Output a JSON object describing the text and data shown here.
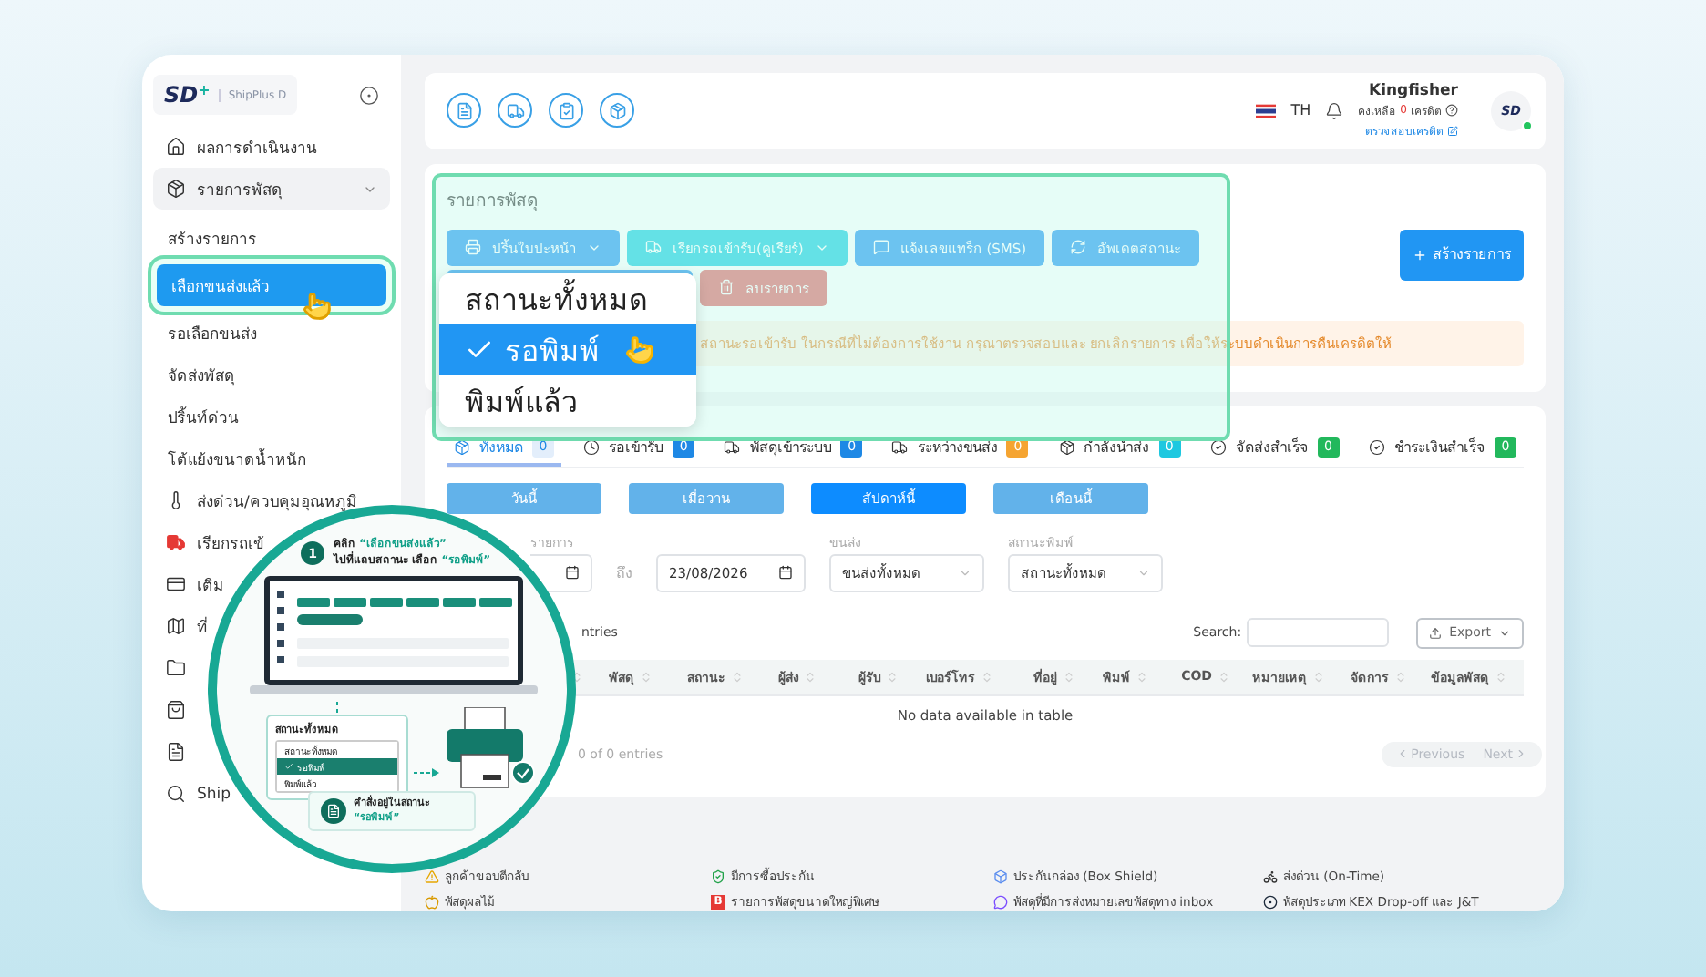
{
  "sidebar": {
    "logo": "SD",
    "logo_plus": "+",
    "brand": "ShipPlus D",
    "items": [
      {
        "label": "ผลการดำเนินงาน"
      },
      {
        "label": "รายการพัสดุ",
        "expanded": true,
        "children": [
          {
            "label": "สร้างรายการ",
            "selected": false
          },
          {
            "label": "เลือกขนส่งแล้ว",
            "selected": true
          },
          {
            "label": "รอเลือกขนส่ง",
            "selected": false
          },
          {
            "label": "จัดส่งพัสดุ",
            "selected": false
          },
          {
            "label": "ปริ้นท์ด่วน",
            "selected": false
          },
          {
            "label": "โต้แย้งขนาดน้ำหนัก",
            "selected": false
          }
        ]
      },
      {
        "label": "ส่งด่วน/ควบคุมอุณหภูมิ"
      },
      {
        "label": "เรียกรถเข้"
      },
      {
        "label": "เติม"
      },
      {
        "label": "ที่"
      }
    ],
    "bottom_items": [
      {
        "label": "Ship"
      }
    ]
  },
  "topbar": {
    "language": "TH",
    "user": {
      "name": "Kingfisher",
      "balance_label": "คงเหลือ",
      "balance": "0",
      "balance_unit": "เครดิต",
      "check_link": "ตรวจสอบเครดิต"
    },
    "avatar_logo": "SD"
  },
  "parcels": {
    "title": "รายการพัสดุ",
    "action_rows": [
      {
        "buttons": [
          {
            "label": "ปริ้นใบปะหน้า",
            "kind": "primary",
            "dropdown": true
          },
          {
            "label": "เรียกรถเข้ารับ(คูเรียร์)",
            "kind": "info",
            "dropdown": true
          },
          {
            "label": "แจ้งเลขแทร็ก (SMS)",
            "kind": "primary",
            "dropdown": false
          },
          {
            "label": "อัพเดตสถานะ",
            "kind": "primary",
            "dropdown": false
          }
        ]
      },
      {
        "buttons": [
          {
            "kind": "primary"
          },
          {
            "label": "ลบรายการ",
            "kind": "danger",
            "dropdown": false
          }
        ]
      }
    ],
    "create_button": "สร้างรายการ",
    "notice": "สถานะรอเข้ารับ ในกรณีที่ไม่ต้องการใช้งาน กรุณาตรวจสอบและ ยกเลิกรายการ เพื่อให้ระบบดำเนินการคืนเครดิตให้"
  },
  "status_menu": {
    "items": [
      {
        "label": "สถานะทั้งหมด",
        "selected": false
      },
      {
        "label": "รอพิมพ์",
        "selected": true
      },
      {
        "label": "พิมพ์แล้ว",
        "selected": false
      }
    ]
  },
  "tabs": [
    {
      "label": "ทั้งหมด",
      "count": "0",
      "selected": true,
      "color": "#e3eefb"
    },
    {
      "label": "รอเข้ารับ",
      "count": "0",
      "selected": false,
      "color": "#1e88e5"
    },
    {
      "label": "พัสดุเข้าระบบ",
      "count": "0",
      "selected": false,
      "color": "#1e88e5"
    },
    {
      "label": "ระหว่างขนส่ง",
      "count": "0",
      "selected": false,
      "color": "#f5a431"
    },
    {
      "label": "กำลังนำส่ง",
      "count": "0",
      "selected": false,
      "color": "#1ec8e0"
    },
    {
      "label": "จัดส่งสำเร็จ",
      "count": "0",
      "selected": false,
      "color": "#22b85c"
    },
    {
      "label": "ชำระเงินสำเร็จ",
      "count": "0",
      "selected": false,
      "color": "#22b85c"
    }
  ],
  "periods": [
    {
      "label": "วันนี้",
      "selected": false
    },
    {
      "label": "เมื่อวาน",
      "selected": false
    },
    {
      "label": "สัปดาห์นี้",
      "selected": true
    },
    {
      "label": "เดือนนี้",
      "selected": false
    }
  ],
  "filters": {
    "date_label": "รายการ",
    "to_label": "ถึง",
    "date_to": "23/08/2026",
    "carrier_label": "ขนส่ง",
    "carrier": "ขนส่งทั้งหมด",
    "print_label": "สถานะพิมพ์",
    "print_status": "สถานะทั้งหมด"
  },
  "table": {
    "entries_text": "ntries",
    "search_label": "Search:",
    "export": "Export",
    "columns": [
      "พัสดุ",
      "สถานะ",
      "ผู้ส่ง",
      "ผู้รับ",
      "เบอร์โทร",
      "ที่อยู่",
      "พิมพ์",
      "COD",
      "หมายเหตุ",
      "จัดการ",
      "ข้อมูลพัสดุ"
    ],
    "empty_text": "No data available in table",
    "info": "0 of 0 entries",
    "pagination": [
      {
        "label": "Previous",
        "disabled": true
      },
      {
        "label": "Next",
        "disabled": true
      }
    ]
  },
  "legend": [
    {
      "label": "ลูกค้าขอบตีกลับ"
    },
    {
      "label": "มีการซื้อประกัน"
    },
    {
      "label": "ประกันกล่อง (Box Shield)"
    },
    {
      "label": "ส่งด่วน (On-Time)"
    },
    {
      "label": "พัสดุผลไม้"
    },
    {
      "label": "รายการพัสดุขนาดใหญ่พิเศษ",
      "badge": "B"
    },
    {
      "label": "พัสดุที่มีการส่งหมายเลขพัสดุทาง inbox"
    },
    {
      "label": "พัสดุประเภท KEX Drop-off และ J&T"
    }
  ],
  "guide": {
    "step": "1",
    "line1_prefix": "คลิก",
    "line1_highlight": "“เลือกขนส่งแล้ว”",
    "line2_prefix": "ไปที่แถบสถานะ เลือก",
    "line2_highlight": "“รอพิมพ์”",
    "menu_title": "สถานะทั้งหมด",
    "menu_items": [
      {
        "label": "สถานะทั้งหมด",
        "selected": false
      },
      {
        "label": "รอพิมพ์",
        "selected": true
      },
      {
        "label": "พิมพ์แล้ว",
        "selected": false
      }
    ],
    "result_line1": "คำสั่งอยู่ในสถานะ",
    "result_line2": "“รอพิมพ์”"
  }
}
